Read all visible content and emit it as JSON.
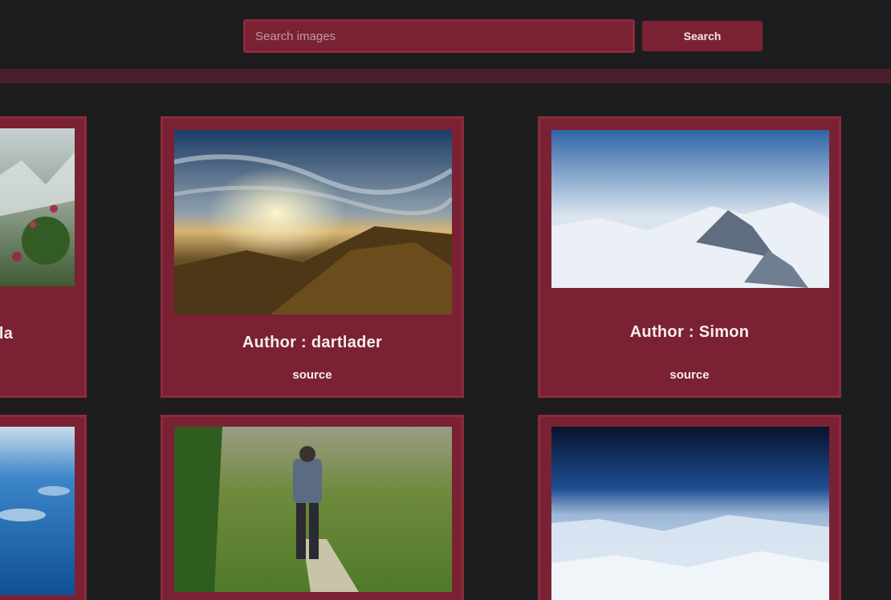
{
  "header": {
    "search_placeholder": "Search images",
    "search_button": "Search"
  },
  "gallery": {
    "cards": [
      {
        "author": "Author : dartlader",
        "source": "source",
        "scene": "mountain sunrise"
      },
      {
        "author": "Author : Simon",
        "source": "source",
        "scene": "snowy peaks"
      },
      {
        "partial_author_suffix": "lla",
        "scene": "alpine flowers"
      },
      {
        "scene": "hiker on trail"
      },
      {
        "scene": "earth from above"
      },
      {
        "scene": "ocean clouds"
      }
    ]
  },
  "colors": {
    "background": "#1d1d1f",
    "accent": "#7a2233",
    "accent_border": "#8b2b3d",
    "divider": "#4a1e28"
  }
}
